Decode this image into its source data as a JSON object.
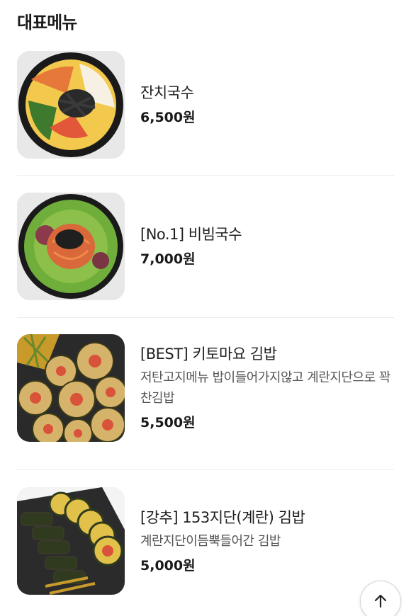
{
  "section": {
    "title": "대표메뉴"
  },
  "menu": [
    {
      "name": "잔치국수",
      "price": "6,500원"
    },
    {
      "name": "[No.1] 비빔국수",
      "price": "7,000원"
    },
    {
      "name": "[BEST] 키토마요 김밥",
      "description": "저탄고지메뉴 밥이들어가지않고 계란지단으로 꽉찬김밥",
      "price": "5,500원"
    },
    {
      "name": "[강추] 153지단(계란) 김밥",
      "description": "계란지단이듬뿍들어간 김밥",
      "price": "5,000원"
    }
  ],
  "scroll_top": {
    "icon": "arrow-up-icon"
  }
}
